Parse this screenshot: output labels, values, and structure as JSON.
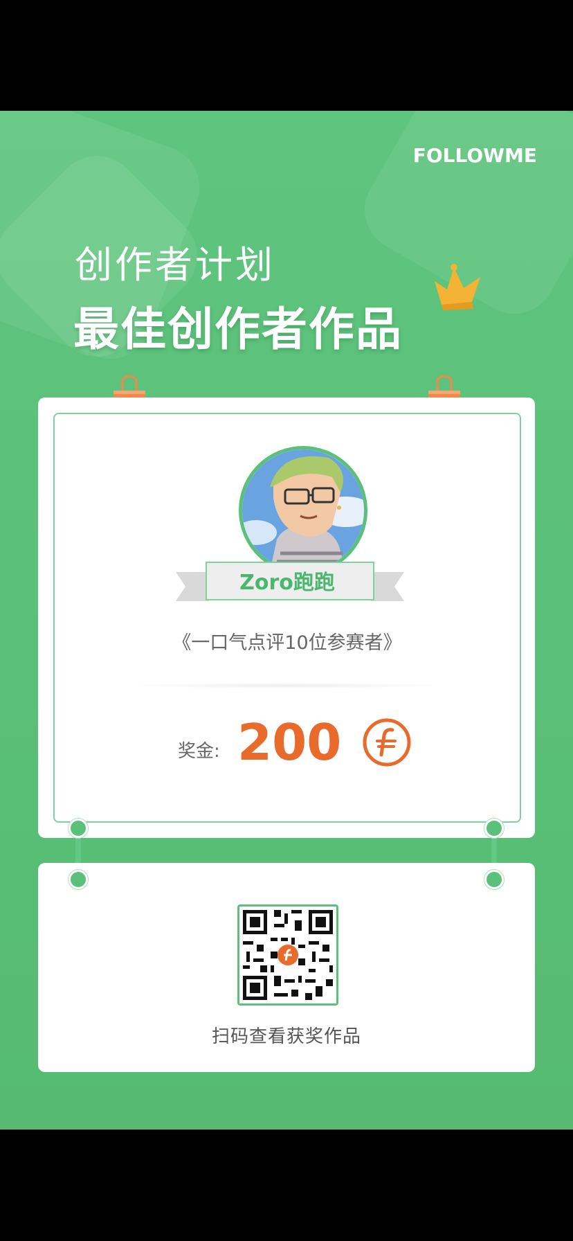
{
  "brand": {
    "logo_text": "FOLLOWME"
  },
  "header": {
    "subtitle": "创作者计划",
    "title": "最佳创作者作品",
    "crown_icon": "crown-icon"
  },
  "winner": {
    "avatar_icon": "avatar-anime-portrait",
    "name": "Zoro跑跑",
    "work_title": "《一口气点评10位参赛者》",
    "prize_label": "奖金:",
    "prize_value": "200",
    "currency_icon": "followme-coin-icon"
  },
  "qr_section": {
    "qr_icon": "qr-code-icon",
    "caption": "扫码查看获奖作品"
  },
  "colors": {
    "background": "#5bc07a",
    "accent_green": "#4bb66d",
    "prize_orange": "#e86b2c",
    "clip_orange": "#f0894a"
  }
}
